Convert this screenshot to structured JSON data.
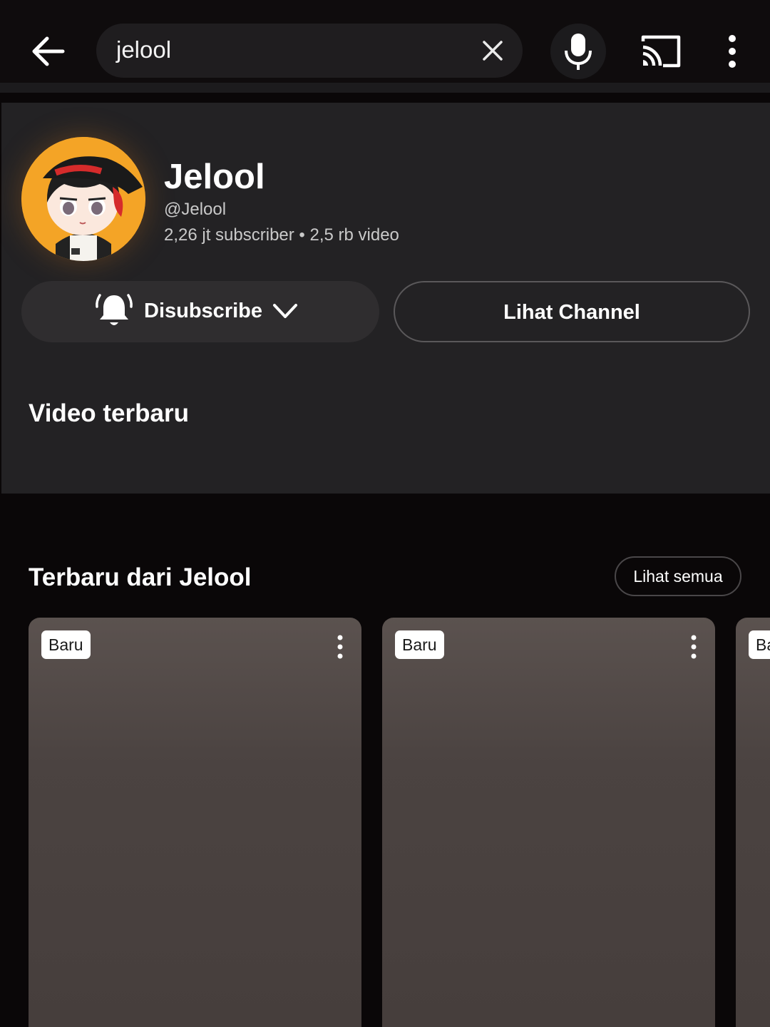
{
  "search": {
    "query": "jelool"
  },
  "icons": {
    "back": "arrow-back-icon",
    "clear": "close-icon",
    "mic": "microphone-icon",
    "cast": "cast-icon",
    "more": "more-vert-icon",
    "bell": "bell-ringing-icon",
    "chevron": "chevron-down-icon"
  },
  "channel": {
    "name": "Jelool",
    "handle": "@Jelool",
    "stats": "2,26 jt subscriber • 2,5 rb video",
    "subscribe_label": "Disubscribe",
    "view_channel_label": "Lihat Channel",
    "latest_videos_heading": "Video terbaru"
  },
  "shelf": {
    "title": "Terbaru dari Jelool",
    "see_all_label": "Lihat semua",
    "cards": [
      {
        "badge": "Baru"
      },
      {
        "badge": "Baru"
      },
      {
        "badge": "Baru"
      }
    ]
  },
  "colors": {
    "background": "#0a0708",
    "card": "#232224",
    "avatar_ring": "#f4a426"
  }
}
